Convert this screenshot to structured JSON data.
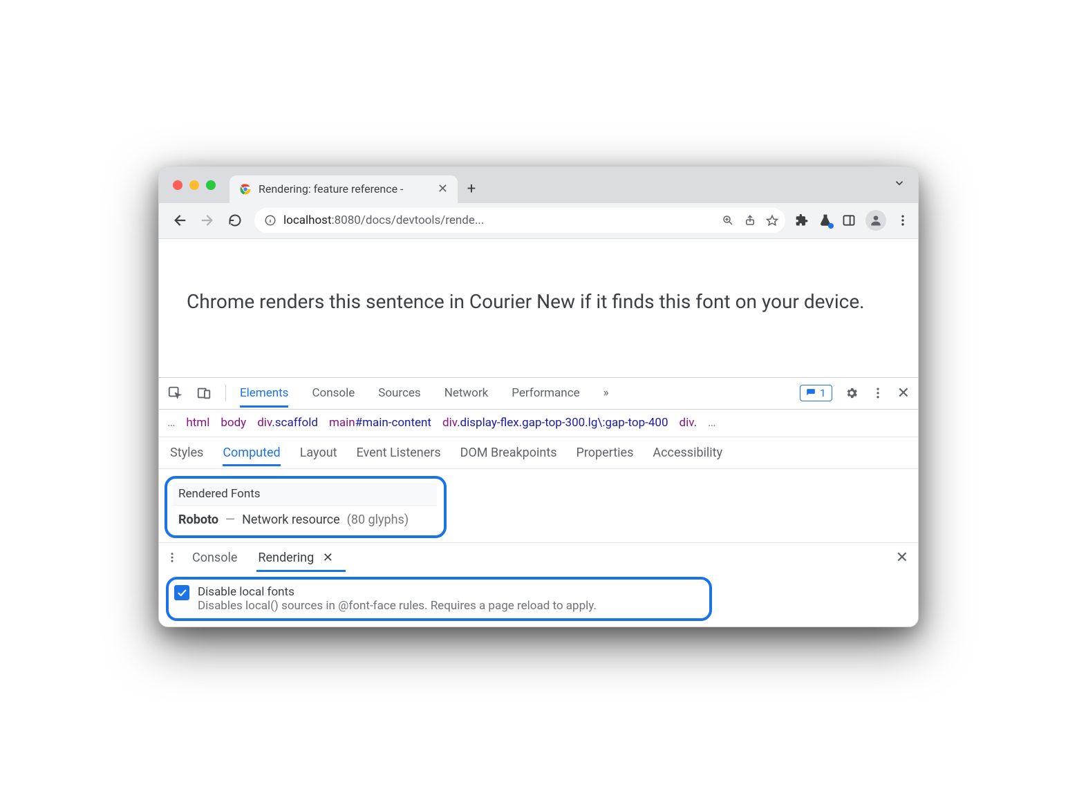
{
  "browser": {
    "tab_title": "Rendering: feature reference -",
    "url_host": "localhost",
    "url_port": ":8080",
    "url_path": "/docs/devtools/rende..."
  },
  "page": {
    "text": "Chrome renders this sentence in Courier New if it finds this font on your device."
  },
  "devtools": {
    "tabs": [
      "Elements",
      "Console",
      "Sources",
      "Network",
      "Performance"
    ],
    "more": "»",
    "issues_count": "1",
    "breadcrumb": {
      "items": [
        {
          "tag": "html"
        },
        {
          "tag": "body"
        },
        {
          "tag": "div",
          "cls": ".scaffold"
        },
        {
          "tag": "main",
          "cls": "#main-content"
        },
        {
          "tag": "div",
          "cls": ".display-flex.gap-top-300.lg\\:gap-top-400"
        },
        {
          "tag": "div",
          "cls": "."
        }
      ]
    },
    "subtabs": [
      "Styles",
      "Computed",
      "Layout",
      "Event Listeners",
      "DOM Breakpoints",
      "Properties",
      "Accessibility"
    ],
    "rendered_fonts": {
      "heading": "Rendered Fonts",
      "name": "Roboto",
      "dash": "—",
      "source": "Network resource",
      "glyphs": "(80 glyphs)"
    },
    "drawer": {
      "tabs": [
        "Console",
        "Rendering"
      ],
      "close_glyph": "✕"
    },
    "setting": {
      "title": "Disable local fonts",
      "desc": "Disables local() sources in @font-face rules. Requires a page reload to apply."
    }
  }
}
